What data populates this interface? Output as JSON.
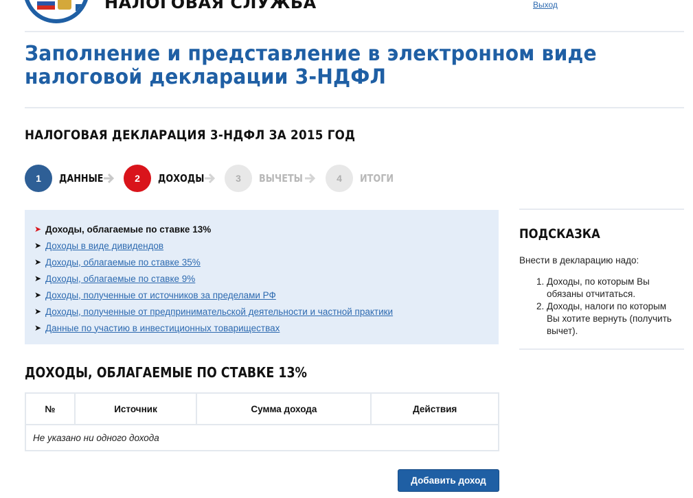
{
  "header": {
    "service_name": "НАЛОГОВАЯ СЛУЖБА",
    "logout_label": "Выход"
  },
  "page_title": "Заполнение и представление в электронном виде налоговой декларации 3-НДФЛ",
  "declaration_title": "НАЛОГОВАЯ ДЕКЛАРАЦИЯ 3-НДФЛ ЗА 2015 ГОД",
  "steps": [
    {
      "number": "1",
      "label": "ДАННЫЕ",
      "state": "done"
    },
    {
      "number": "2",
      "label": "ДОХОДЫ",
      "state": "active"
    },
    {
      "number": "3",
      "label": "ВЫЧЕТЫ",
      "state": "todo"
    },
    {
      "number": "4",
      "label": "ИТОГИ",
      "state": "todo"
    }
  ],
  "income_types": [
    {
      "label": "Доходы, облагаемые по ставке 13%",
      "current": true
    },
    {
      "label": "Доходы в виде дивидендов",
      "current": false
    },
    {
      "label": "Доходы, облагаемые по ставке 35%",
      "current": false
    },
    {
      "label": "Доходы, облагаемые по ставке 9%",
      "current": false
    },
    {
      "label": "Доходы, полученные от источников за пределами РФ",
      "current": false
    },
    {
      "label": "Доходы, полученные от предпринимательской деятельности и частной практики",
      "current": false
    },
    {
      "label": "Данные по участию в инвестиционных товариществах",
      "current": false
    }
  ],
  "section_title": "ДОХОДЫ, ОБЛАГАЕМЫЕ ПО СТАВКЕ 13%",
  "table": {
    "columns": [
      "№",
      "Источник",
      "Сумма дохода",
      "Действия"
    ],
    "empty_message": "Не указано ни одного дохода"
  },
  "add_button_label": "Добавить доход",
  "hint": {
    "title": "ПОДСКАЗКА",
    "intro": "Внести в декларацию надо:",
    "items": [
      "Доходы, по которым Вы обязаны отчитаться.",
      "Доходы, налоги по которым Вы хотите вернуть (получить вычет)."
    ]
  },
  "colors": {
    "brand_blue": "#1f5fa4",
    "step_done": "#2e5f96",
    "step_active": "#d9141b",
    "step_todo": "#e8e8e8",
    "panel_bg": "#e4edf8",
    "link": "#2d6ab0"
  }
}
